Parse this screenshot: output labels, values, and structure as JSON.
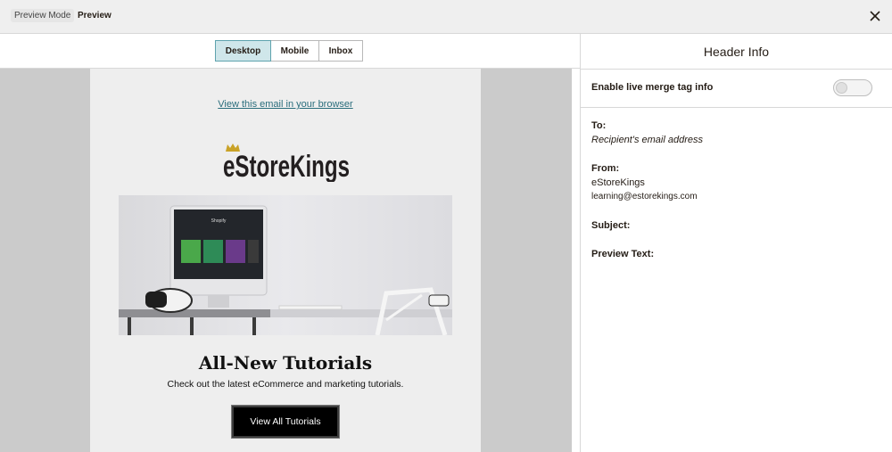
{
  "topbar": {
    "mode_label": "Preview Mode",
    "title": "Preview"
  },
  "tabs": [
    {
      "label": "Desktop",
      "active": true
    },
    {
      "label": "Mobile",
      "active": false
    },
    {
      "label": "Inbox",
      "active": false
    }
  ],
  "email": {
    "view_link": "View this email in your browser",
    "logo_text": "eStoreKings",
    "hero_screen_title": "Shopify",
    "title": "All-New Tutorials",
    "subtitle": "Check out the latest eCommerce and marketing tutorials.",
    "cta_label": "View All Tutorials"
  },
  "panel": {
    "header": "Header Info",
    "merge_label": "Enable live merge tag info",
    "merge_enabled": false,
    "to_label": "To:",
    "to_value": "Recipient's email address",
    "from_label": "From:",
    "from_name": "eStoreKings",
    "from_email": "learning@estorekings.com",
    "subject_label": "Subject:",
    "preview_label": "Preview Text:"
  },
  "colors": {
    "active_tab": "#cfe6ea",
    "link": "#2a6d7c",
    "crown": "#c9a227"
  }
}
